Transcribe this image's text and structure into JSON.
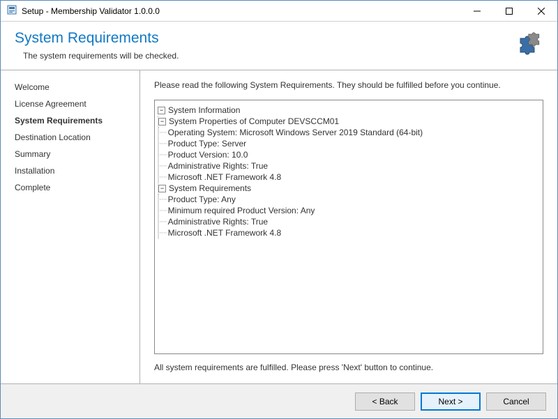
{
  "titlebar": {
    "text": "Setup - Membership Validator 1.0.0.0"
  },
  "header": {
    "title": "System Requirements",
    "subtitle": "The system requirements will be checked."
  },
  "sidebar": {
    "steps": [
      {
        "label": "Welcome",
        "active": false
      },
      {
        "label": "License Agreement",
        "active": false
      },
      {
        "label": "System Requirements",
        "active": true
      },
      {
        "label": "Destination Location",
        "active": false
      },
      {
        "label": "Summary",
        "active": false
      },
      {
        "label": "Installation",
        "active": false
      },
      {
        "label": "Complete",
        "active": false
      }
    ]
  },
  "content": {
    "instruction": "Please read the following System Requirements. They should be fulfilled before you continue.",
    "tree": {
      "root": {
        "label": "System Information",
        "expanded": true,
        "children": [
          {
            "label": "System Properties of Computer DEVSCCM01",
            "expanded": true,
            "children": [
              {
                "label": "Operating System: Microsoft Windows Server 2019 Standard (64-bit)"
              },
              {
                "label": "Product Type: Server"
              },
              {
                "label": "Product Version: 10.0"
              },
              {
                "label": "Administrative Rights: True"
              },
              {
                "label": "Microsoft .NET Framework 4.8"
              }
            ]
          },
          {
            "label": "System Requirements",
            "expanded": true,
            "children": [
              {
                "label": "Product Type: Any"
              },
              {
                "label": "Minimum required Product Version: Any"
              },
              {
                "label": "Administrative Rights: True"
              },
              {
                "label": "Microsoft .NET Framework 4.8"
              }
            ]
          }
        ]
      }
    },
    "status": "All system requirements are fulfilled. Please press 'Next' button to continue."
  },
  "footer": {
    "back": "< Back",
    "next": "Next >",
    "cancel": "Cancel"
  }
}
